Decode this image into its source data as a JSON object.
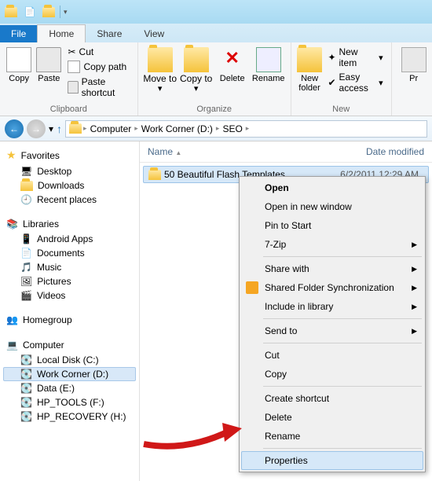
{
  "tabs": {
    "file": "File",
    "home": "Home",
    "share": "Share",
    "view": "View"
  },
  "ribbon": {
    "clipboard": {
      "label": "Clipboard",
      "copy": "Copy",
      "paste": "Paste",
      "cut": "Cut",
      "copy_path": "Copy path",
      "paste_shortcut": "Paste shortcut"
    },
    "organize": {
      "label": "Organize",
      "move_to": "Move to",
      "copy_to": "Copy to",
      "delete": "Delete",
      "rename": "Rename"
    },
    "new": {
      "label": "New",
      "new_folder": "New folder",
      "new_item": "New item",
      "easy_access": "Easy access"
    },
    "pr": "Pr"
  },
  "breadcrumb": [
    "Computer",
    "Work Corner (D:)",
    "SEO"
  ],
  "columns": {
    "name": "Name",
    "date": "Date modified"
  },
  "file": {
    "name": "50 Beautiful Flash Templates",
    "date": "6/2/2011 12:29 AM"
  },
  "sidebar": {
    "favorites": "Favorites",
    "fav_items": [
      "Desktop",
      "Downloads",
      "Recent places"
    ],
    "libraries": "Libraries",
    "lib_items": [
      "Android Apps",
      "Documents",
      "Music",
      "Pictures",
      "Videos"
    ],
    "homegroup": "Homegroup",
    "computer": "Computer",
    "drives": [
      "Local Disk (C:)",
      "Work Corner (D:)",
      "Data (E:)",
      "HP_TOOLS (F:)",
      "HP_RECOVERY (H:)"
    ],
    "selected_drive": 1
  },
  "context_menu": {
    "open": "Open",
    "open_new": "Open in new window",
    "pin": "Pin to Start",
    "sevenzip": "7-Zip",
    "share": "Share with",
    "sfs": "Shared Folder Synchronization",
    "include": "Include in library",
    "send": "Send to",
    "cut": "Cut",
    "copy": "Copy",
    "shortcut": "Create shortcut",
    "delete": "Delete",
    "rename": "Rename",
    "properties": "Properties"
  }
}
